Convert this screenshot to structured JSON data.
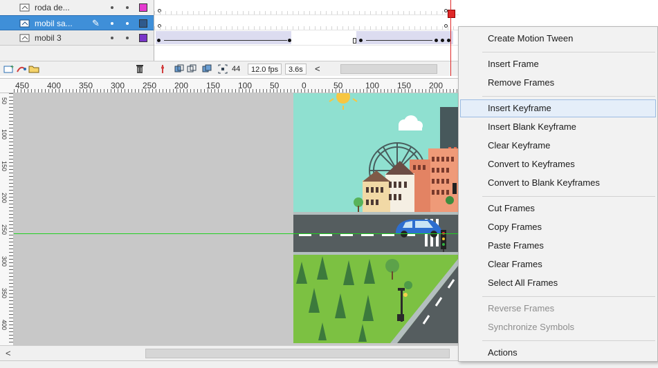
{
  "layers": [
    {
      "name": "roda de...",
      "color": "#e53ad0",
      "selected": false,
      "editing": false
    },
    {
      "name": "mobil sa...",
      "color": "#2f5a8c",
      "selected": true,
      "editing": true
    },
    {
      "name": "mobil 3",
      "color": "#7a35c9",
      "selected": false,
      "editing": false
    }
  ],
  "timeline_status": {
    "current_frame": "44",
    "frame_rate": "12.0 fps",
    "elapsed_time": "3.6s",
    "scroll_left_glyph": "<"
  },
  "ruler": {
    "labels": [
      "450",
      "400",
      "350",
      "300",
      "250",
      "200",
      "150",
      "100",
      "50",
      "0",
      "50",
      "100",
      "150",
      "200",
      "2"
    ],
    "vertical_labels": [
      "50",
      "100",
      "150",
      "200",
      "250",
      "300",
      "350",
      "400"
    ]
  },
  "stage": {
    "hscroll_left_glyph": "<",
    "guide_color": "#22d022"
  },
  "context_menu": {
    "groups": [
      {
        "items": [
          {
            "label": "Create Motion Tween",
            "enabled": true,
            "highlighted": false
          }
        ]
      },
      {
        "items": [
          {
            "label": "Insert Frame",
            "enabled": true,
            "highlighted": false
          },
          {
            "label": "Remove Frames",
            "enabled": true,
            "highlighted": false
          }
        ]
      },
      {
        "items": [
          {
            "label": "Insert Keyframe",
            "enabled": true,
            "highlighted": true
          },
          {
            "label": "Insert Blank Keyframe",
            "enabled": true,
            "highlighted": false
          },
          {
            "label": "Clear Keyframe",
            "enabled": true,
            "highlighted": false
          },
          {
            "label": "Convert to Keyframes",
            "enabled": true,
            "highlighted": false
          },
          {
            "label": "Convert to Blank Keyframes",
            "enabled": true,
            "highlighted": false
          }
        ]
      },
      {
        "items": [
          {
            "label": "Cut Frames",
            "enabled": true,
            "highlighted": false
          },
          {
            "label": "Copy Frames",
            "enabled": true,
            "highlighted": false
          },
          {
            "label": "Paste Frames",
            "enabled": true,
            "highlighted": false
          },
          {
            "label": "Clear Frames",
            "enabled": true,
            "highlighted": false
          },
          {
            "label": "Select All Frames",
            "enabled": true,
            "highlighted": false
          }
        ]
      },
      {
        "items": [
          {
            "label": "Reverse Frames",
            "enabled": false,
            "highlighted": false
          },
          {
            "label": "Synchronize Symbols",
            "enabled": false,
            "highlighted": false
          }
        ]
      },
      {
        "items": [
          {
            "label": "Actions",
            "enabled": true,
            "highlighted": false
          }
        ]
      }
    ]
  },
  "colors": {
    "selected_layer": "#3f8fd8",
    "playhead": "#e02828",
    "menu_highlight": "#e5eef9"
  }
}
